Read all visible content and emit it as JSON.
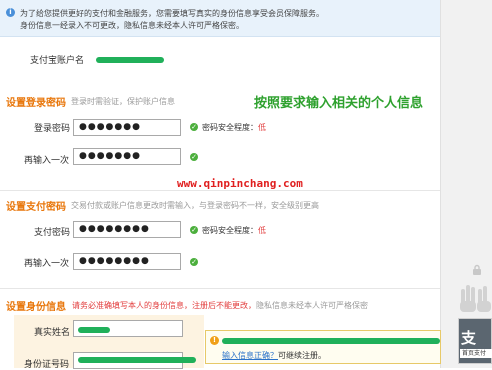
{
  "notice": {
    "line1": "为了给您提供更好的支付和金融服务，您需要填写真实的身份信息享受会员保障服务。",
    "line2": "身份信息一经录入不可更改，隐私信息未经本人许可严格保密。"
  },
  "alipay_account": {
    "label": "支付宝账户名"
  },
  "login_section": {
    "title": "设置登录密码",
    "hint": "登录时需验证，保护账户信息",
    "password_label": "登录密码",
    "password_value": "●●●●●●●",
    "confirm_label": "再输入一次",
    "confirm_value": "●●●●●●●",
    "strength_label": "密码安全程度：",
    "strength_value": "低"
  },
  "annotation": "按照要求输入相关的个人信息",
  "watermark": "www.qinpinchang.com",
  "pay_section": {
    "title": "设置支付密码",
    "hint": "交易付款或账户信息更改时需输入，与登录密码不一样，安全级别更高",
    "password_label": "支付密码",
    "password_value": "●●●●●●●●",
    "confirm_label": "再输入一次",
    "confirm_value": "●●●●●●●●",
    "strength_label": "密码安全程度：",
    "strength_value": "低"
  },
  "identity_section": {
    "title": "设置身份信息",
    "hint_red": "请务必准确填写本人的身份信息，注册后不能更改，",
    "hint_gray": "隐私信息未经本人许可严格保密",
    "name_label": "真实姓名",
    "id_label": "身份证号码",
    "tip_link": "输入信息正确？",
    "tip_text": "可继续注册。"
  },
  "support": {
    "char": "支",
    "sub": "首页支付"
  },
  "colors": {
    "accent_orange": "#e8760a",
    "ok_green": "#4caf3d",
    "annotation_green": "#2ea12e",
    "watermark_red": "#e01e1e",
    "link_blue": "#2b72c9"
  }
}
